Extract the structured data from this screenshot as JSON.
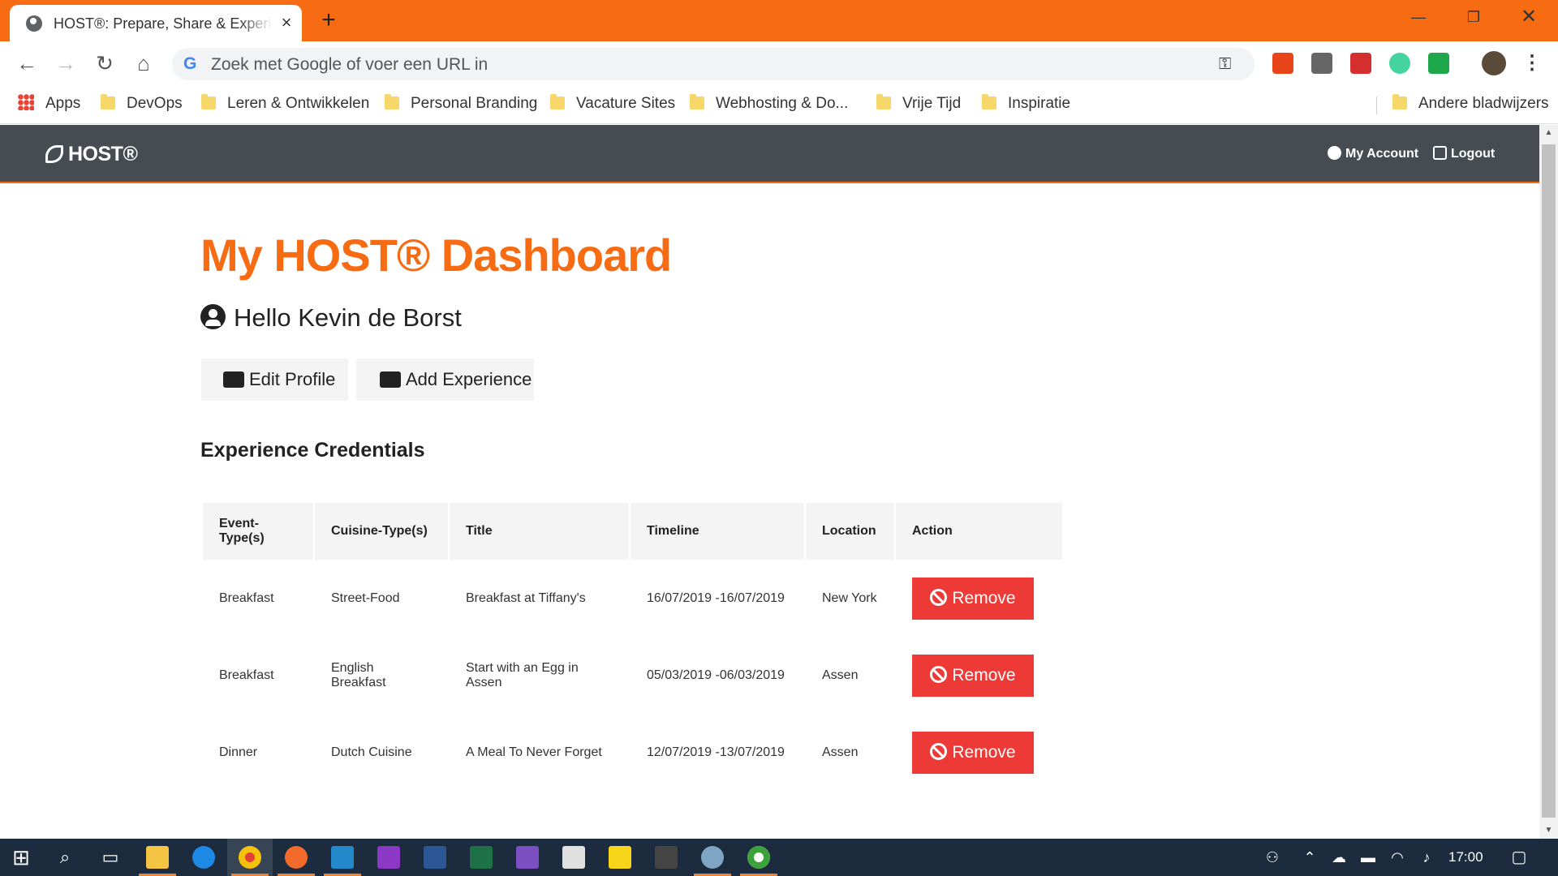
{
  "browser": {
    "tab_title": "HOST®: Prepare, Share & Experience",
    "omnibox_placeholder": "Zoek met Google of voer een URL in",
    "bookmarks": [
      "Apps",
      "DevOps",
      "Leren & Ontwikkelen",
      "Personal Branding",
      "Vacature Sites",
      "Webhosting & Do...",
      "Vrije Tijd",
      "Inspiratie"
    ],
    "other_bookmarks": "Andere bladwijzers"
  },
  "site": {
    "logo": "HOST®",
    "nav": {
      "account": "My Account",
      "logout": "Logout"
    }
  },
  "dashboard": {
    "title": "My HOST® Dashboard",
    "greeting": "Hello Kevin de Borst",
    "edit_profile": "Edit Profile",
    "add_experience": "Add Experience",
    "section_title": "Experience Credentials",
    "table": {
      "headers": [
        "Event-Type(s)",
        "Cuisine-Type(s)",
        "Title",
        "Timeline",
        "Location",
        "Action"
      ],
      "rows": [
        {
          "event": "Breakfast",
          "cuisine": "Street-Food",
          "title": "Breakfast at Tiffany's",
          "timeline": "16/07/2019 -16/07/2019",
          "location": "New York",
          "action": "Remove"
        },
        {
          "event": "Breakfast",
          "cuisine": "English Breakfast",
          "title": "Start with an Egg in Assen",
          "timeline": "05/03/2019 -06/03/2019",
          "location": "Assen",
          "action": "Remove"
        },
        {
          "event": "Dinner",
          "cuisine": "Dutch Cuisine",
          "title": "A Meal To Never Forget",
          "timeline": "12/07/2019 -13/07/2019",
          "location": "Assen",
          "action": "Remove"
        }
      ]
    }
  },
  "taskbar": {
    "clock": "17:00"
  },
  "colors": {
    "brand_orange": "#f76b12",
    "nav_dark": "#474b52",
    "remove_red": "#ee3a36",
    "taskbar": "#1c2b3d"
  },
  "icons": {
    "tab": "globe-icon",
    "user": "user-circle-icon",
    "edit": "user-edit-icon",
    "add": "store-icon",
    "remove": "ban-icon",
    "logout": "sign-out-icon"
  }
}
